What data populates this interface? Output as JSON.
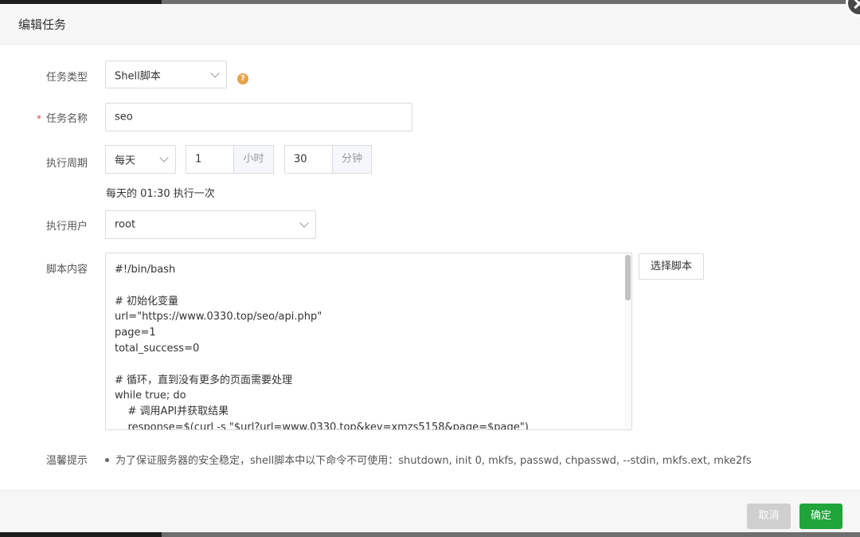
{
  "dialog": {
    "title": "编辑任务"
  },
  "labels": {
    "task_type": "任务类型",
    "task_name": "任务名称",
    "required_mark": "*",
    "cycle": "执行周期",
    "user": "执行用户",
    "script": "脚本内容",
    "tips": "温馨提示"
  },
  "task_type": {
    "value": "Shell脚本",
    "help_icon": "question-circle-icon",
    "help_glyph": "?"
  },
  "task_name": {
    "value": "seo"
  },
  "cycle": {
    "period": "每天",
    "hour": "1",
    "hour_unit": "小时",
    "minute": "30",
    "minute_unit": "分钟",
    "hint": "每天的 01:30 执行一次"
  },
  "user": {
    "value": "root"
  },
  "script": {
    "lines": [
      "#!/bin/bash",
      "",
      "# 初始化变量",
      "url=\"https://www.0330.top/seo/api.php\"",
      "page=1",
      "total_success=0",
      "",
      "# 循环，直到没有更多的页面需要处理",
      "while true; do",
      "    # 调用API并获取结果",
      "    response=$(curl -s \"$url?url=www.0330.top&key=xmzs5158&page=$page\")"
    ],
    "choose_button": "选择脚本"
  },
  "tips": {
    "text": "为了保证服务器的安全稳定，shell脚本中以下命令不可使用：shutdown, init 0, mkfs, passwd, chpasswd, --stdin, mkfs.ext, mke2fs"
  },
  "footer": {
    "cancel": "取消",
    "confirm": "确定"
  },
  "colors": {
    "primary": "#20a53a",
    "help": "#e5a34a",
    "required": "#e2483d"
  }
}
